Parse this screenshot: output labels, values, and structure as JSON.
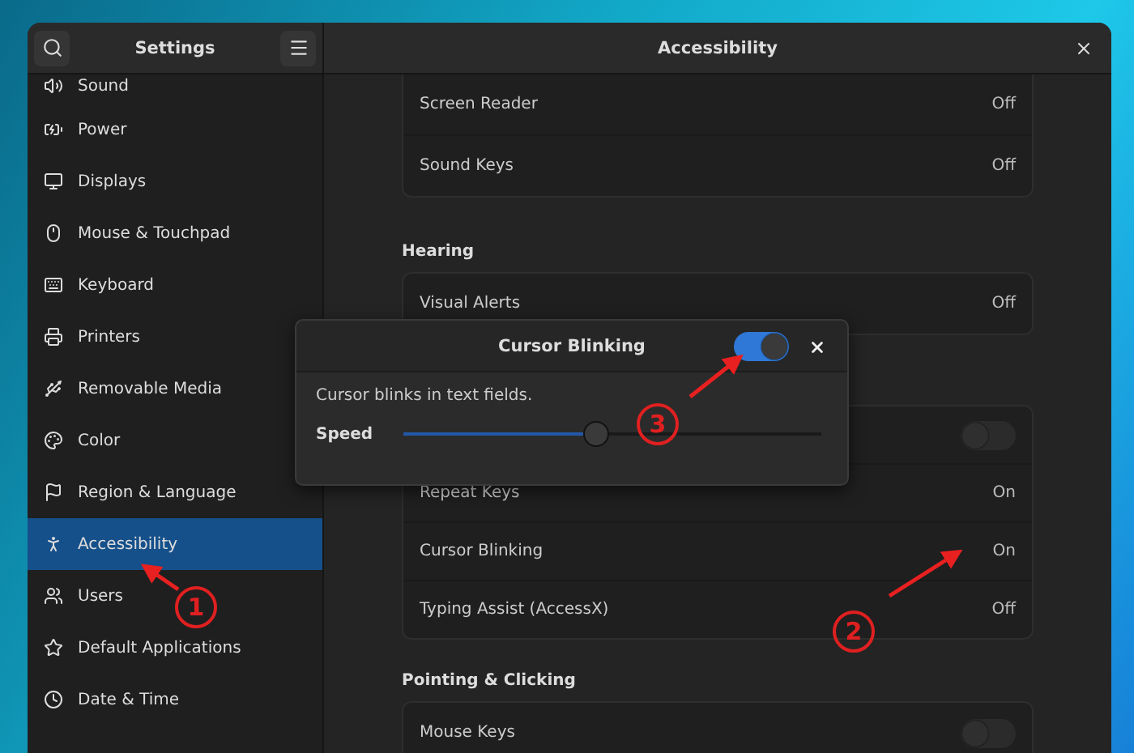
{
  "sidebar": {
    "title": "Settings",
    "items": [
      {
        "label": "Sound",
        "selected": false
      },
      {
        "label": "Power",
        "selected": false
      },
      {
        "label": "Displays",
        "selected": false
      },
      {
        "label": "Mouse & Touchpad",
        "selected": false
      },
      {
        "label": "Keyboard",
        "selected": false
      },
      {
        "label": "Printers",
        "selected": false
      },
      {
        "label": "Removable Media",
        "selected": false
      },
      {
        "label": "Color",
        "selected": false
      },
      {
        "label": "Region & Language",
        "selected": false
      },
      {
        "label": "Accessibility",
        "selected": true
      },
      {
        "label": "Users",
        "selected": false
      },
      {
        "label": "Default Applications",
        "selected": false
      },
      {
        "label": "Date & Time",
        "selected": false
      }
    ]
  },
  "content": {
    "title": "Accessibility",
    "sections": [
      {
        "rows": [
          {
            "kind": "value",
            "label": "Screen Reader",
            "value": "Off"
          },
          {
            "kind": "value",
            "label": "Sound Keys",
            "value": "Off"
          }
        ]
      },
      {
        "heading": "Hearing",
        "rows": [
          {
            "kind": "value",
            "label": "Visual Alerts",
            "value": "Off"
          }
        ]
      },
      {
        "rows": [
          {
            "kind": "switch",
            "on": false
          },
          {
            "kind": "value",
            "label": "Repeat Keys",
            "value": "On"
          },
          {
            "kind": "value",
            "label": "Cursor Blinking",
            "value": "On"
          },
          {
            "kind": "value",
            "label": "Typing Assist (AccessX)",
            "value": "Off"
          }
        ]
      },
      {
        "heading": "Pointing & Clicking",
        "rows": [
          {
            "kind": "switch",
            "label": "Mouse Keys",
            "on": false
          }
        ]
      }
    ]
  },
  "popover": {
    "title": "Cursor Blinking",
    "on": true,
    "description": "Cursor blinks in text fields.",
    "slider": {
      "label": "Speed",
      "level": 0.46
    }
  },
  "annotations": [
    {
      "number": "1"
    },
    {
      "number": "2"
    },
    {
      "number": "3"
    }
  ]
}
